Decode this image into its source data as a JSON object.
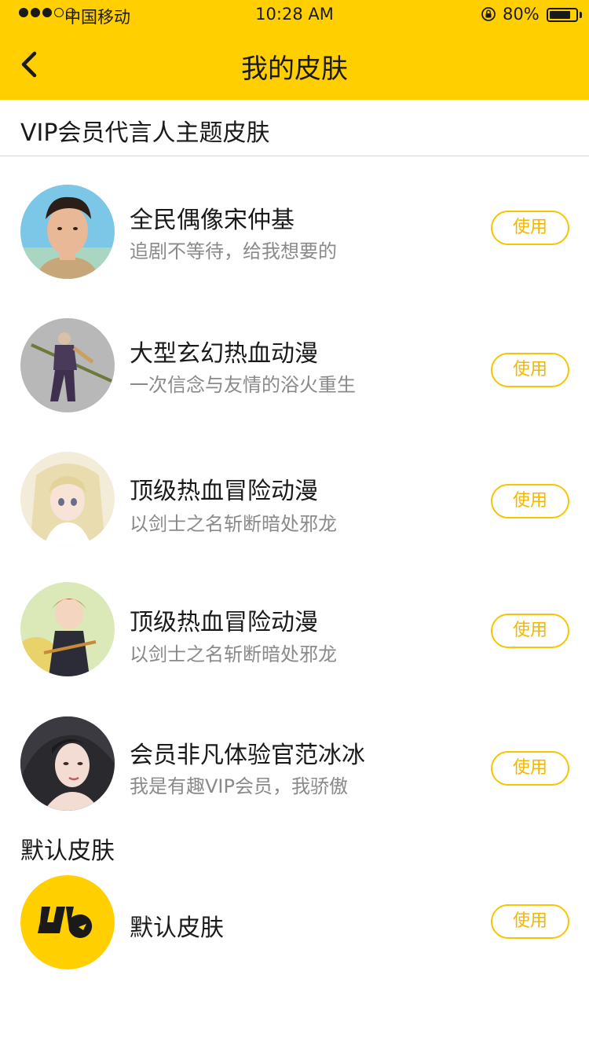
{
  "status_bar": {
    "carrier": "中国移动",
    "time": "10:28 AM",
    "battery": "80%",
    "battery_level": 0.8
  },
  "nav": {
    "title": "我的皮肤",
    "back_icon": "chevron-left-icon"
  },
  "vip_section": {
    "title": "VIP会员代言人主题皮肤",
    "items": [
      {
        "title": "全民偶像宋仲基",
        "subtitle": "追剧不等待，给我想要的",
        "button": "使用"
      },
      {
        "title": "大型玄幻热血动漫",
        "subtitle": "一次信念与友情的浴火重生",
        "button": "使用"
      },
      {
        "title": "顶级热血冒险动漫",
        "subtitle": "以剑士之名斩断暗处邪龙",
        "button": "使用"
      },
      {
        "title": "顶级热血冒险动漫",
        "subtitle": "以剑士之名斩断暗处邪龙",
        "button": "使用"
      },
      {
        "title": "会员非凡体验官范冰冰",
        "subtitle": "我是有趣VIP会员，我骄傲",
        "button": "使用"
      }
    ]
  },
  "default_section": {
    "title": "默认皮肤",
    "item": {
      "title": "默认皮肤",
      "button": "使用"
    }
  },
  "colors": {
    "accent": "#FFCF00",
    "button_border": "#F7C500",
    "button_text": "#F2B800"
  }
}
